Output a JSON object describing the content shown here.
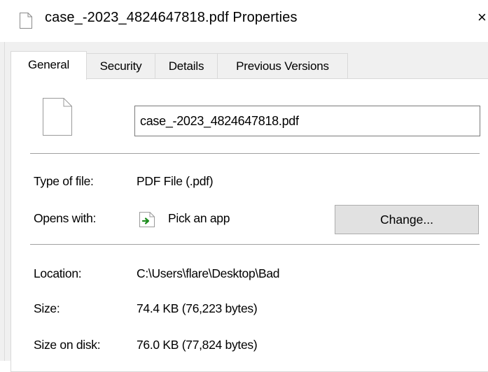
{
  "window": {
    "title": "case_-2023_4824647818.pdf Properties",
    "close_glyph": "×"
  },
  "tabs": [
    {
      "label": "General",
      "active": true
    },
    {
      "label": "Security",
      "active": false
    },
    {
      "label": "Details",
      "active": false
    },
    {
      "label": "Previous Versions",
      "active": false
    }
  ],
  "general": {
    "file_name": "case_-2023_4824647818.pdf",
    "type_of_file": {
      "label": "Type of file:",
      "value": "PDF File (.pdf)"
    },
    "opens_with": {
      "label": "Opens with:",
      "app": "Pick an app",
      "change_button": "Change..."
    },
    "location": {
      "label": "Location:",
      "value": "C:\\Users\\flare\\Desktop\\Bad"
    },
    "size": {
      "label": "Size:",
      "value": "74.4 KB (76,223 bytes)"
    },
    "size_on_disk": {
      "label": "Size on disk:",
      "value": "76.0 KB (77,824 bytes)"
    }
  },
  "icons": {
    "title": "document-icon",
    "file": "document-icon",
    "app": "pick-app-icon"
  },
  "colors": {
    "dialog_background": "#f0f0f0",
    "panel_background": "#ffffff",
    "button_face": "#e1e1e1",
    "app_icon_arrow": "#1e8c1e"
  }
}
